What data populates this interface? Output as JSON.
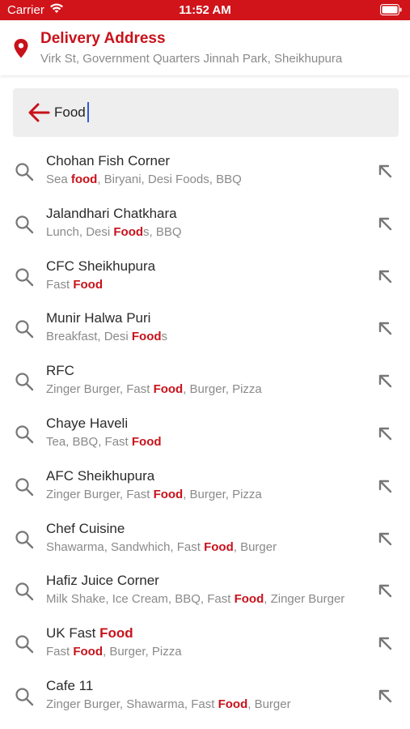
{
  "status_bar": {
    "carrier": "Carrier",
    "time": "11:52 AM"
  },
  "header": {
    "title": "Delivery Address",
    "address": "Virk St, Government Quarters Jinnah Park, Sheikhupura"
  },
  "search": {
    "value": "Food",
    "placeholder": ""
  },
  "colors": {
    "brand_red": "#d0141a",
    "highlight": "#c8121b",
    "muted_text": "#8a8a8a"
  },
  "results": [
    {
      "name": "Chohan Fish Corner",
      "parts": [
        [
          "Sea ",
          0
        ],
        [
          "food",
          1
        ],
        [
          ", Biryani, Desi Foods, BBQ",
          0
        ]
      ]
    },
    {
      "name": "Jalandhari Chatkhara",
      "parts": [
        [
          "Lunch, Desi ",
          0
        ],
        [
          "Food",
          1
        ],
        [
          "s, BBQ",
          0
        ]
      ]
    },
    {
      "name": "CFC Sheikhupura",
      "parts": [
        [
          "Fast ",
          0
        ],
        [
          "Food",
          1
        ]
      ]
    },
    {
      "name": "Munir Halwa Puri",
      "parts": [
        [
          "Breakfast, Desi ",
          0
        ],
        [
          "Food",
          1
        ],
        [
          "s",
          0
        ]
      ]
    },
    {
      "name": "RFC",
      "parts": [
        [
          "Zinger Burger, Fast ",
          0
        ],
        [
          "Food",
          1
        ],
        [
          ", Burger, Pizza",
          0
        ]
      ]
    },
    {
      "name": "Chaye Haveli",
      "parts": [
        [
          "Tea, BBQ, Fast ",
          0
        ],
        [
          "Food",
          1
        ]
      ]
    },
    {
      "name": "AFC Sheikhupura",
      "parts": [
        [
          "Zinger Burger, Fast ",
          0
        ],
        [
          "Food",
          1
        ],
        [
          ", Burger, Pizza",
          0
        ]
      ]
    },
    {
      "name": "Chef Cuisine",
      "parts": [
        [
          "Shawarma, Sandwhich, Fast ",
          0
        ],
        [
          "Food",
          1
        ],
        [
          ", Burger",
          0
        ]
      ]
    },
    {
      "name": "Hafiz Juice Corner",
      "parts": [
        [
          "Milk Shake, Ice Cream, BBQ, Fast ",
          0
        ],
        [
          "Food",
          1
        ],
        [
          ", Zinger Burger",
          0
        ]
      ]
    },
    {
      "name_parts": [
        [
          "UK Fast ",
          0
        ],
        [
          "Food",
          1
        ]
      ],
      "parts": [
        [
          "Fast ",
          0
        ],
        [
          "Food",
          1
        ],
        [
          ", Burger, Pizza",
          0
        ]
      ]
    },
    {
      "name": "Cafe 11",
      "parts": [
        [
          "Zinger Burger, Shawarma, Fast ",
          0
        ],
        [
          "Food",
          1
        ],
        [
          ", Burger",
          0
        ]
      ]
    }
  ],
  "icons": {
    "row_leading": "search-icon",
    "row_trailing": "arrow-up-left-icon",
    "back": "back-arrow-icon",
    "header": "location-pin-icon"
  }
}
